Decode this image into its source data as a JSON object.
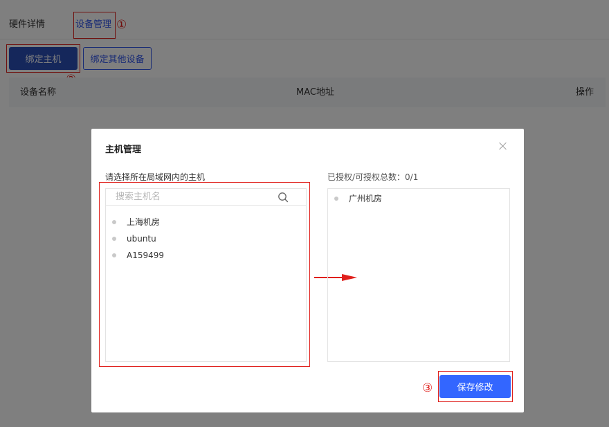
{
  "tabs": {
    "hardware_details": "硬件详情",
    "device_management": "设备管理"
  },
  "toolbar": {
    "bind_host": "绑定主机",
    "bind_other": "绑定其他设备"
  },
  "table": {
    "columns": [
      "设备名称",
      "MAC地址",
      "操作"
    ]
  },
  "modal": {
    "title": "主机管理",
    "left_label": "请选择所在局域网内的主机",
    "search_placeholder": "搜索主机名",
    "available_hosts": [
      "上海机房",
      "ubuntu",
      "A159499"
    ],
    "right_label": "已授权/可授权总数：0/1",
    "authorized_hosts": [
      "广州机房"
    ],
    "save_label": "保存修改"
  },
  "annotations": {
    "step1": "①",
    "step2": "②",
    "step3": "③"
  },
  "colors": {
    "accent": "#2f54eb",
    "primary_button": "#2b4eb7",
    "save_button": "#3366ff",
    "annotation_red": "#e0201c"
  }
}
